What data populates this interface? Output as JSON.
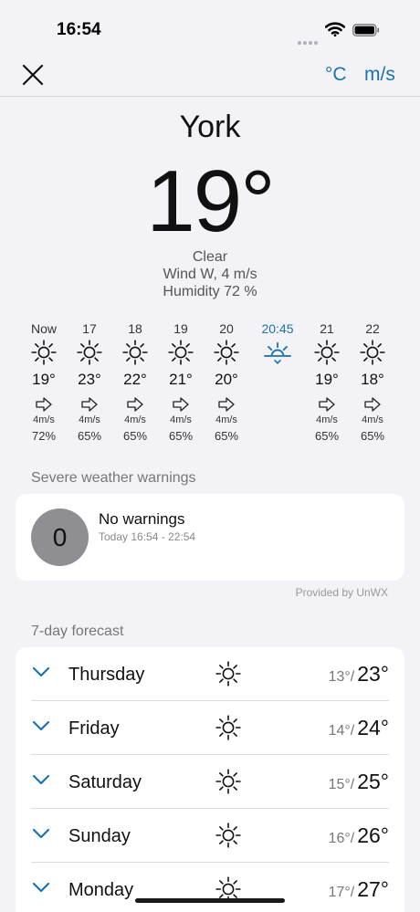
{
  "status": {
    "time": "16:54"
  },
  "toolbar": {
    "temp_unit": "°C",
    "wind_unit": "m/s"
  },
  "current": {
    "city": "York",
    "temperature": "19°",
    "condition": "Clear",
    "wind": "Wind W, 4 m/s",
    "humidity": "Humidity 72 %"
  },
  "hourly": [
    {
      "label": "Now",
      "icon": "sun-icon",
      "temp": "19°",
      "wind_dir": "W",
      "speed": "4m/s",
      "humidity": "72%"
    },
    {
      "label": "17",
      "icon": "sun-icon",
      "temp": "23°",
      "wind_dir": "W",
      "speed": "4m/s",
      "humidity": "65%"
    },
    {
      "label": "18",
      "icon": "sun-icon",
      "temp": "22°",
      "wind_dir": "W",
      "speed": "4m/s",
      "humidity": "65%"
    },
    {
      "label": "19",
      "icon": "sun-icon",
      "temp": "21°",
      "wind_dir": "W",
      "speed": "4m/s",
      "humidity": "65%"
    },
    {
      "label": "20",
      "icon": "sun-icon",
      "temp": "20°",
      "wind_dir": "W",
      "speed": "4m/s",
      "humidity": "65%"
    },
    {
      "label": "20:45",
      "icon": "sunset-icon",
      "accent": true
    },
    {
      "label": "21",
      "icon": "sun-icon",
      "temp": "19°",
      "wind_dir": "W",
      "speed": "4m/s",
      "humidity": "65%"
    },
    {
      "label": "22",
      "icon": "sun-icon",
      "temp": "18°",
      "wind_dir": "W",
      "speed": "4m/s",
      "humidity": "65%"
    }
  ],
  "warnings": {
    "section_title": "Severe weather warnings",
    "count": "0",
    "title": "No warnings",
    "period": "Today 16:54 - 22:54",
    "provider": "Provided by UnWX"
  },
  "forecast": {
    "section_title": "7-day forecast",
    "days": [
      {
        "day": "Thursday",
        "icon": "sun-icon",
        "low": "13°/",
        "high": "23°"
      },
      {
        "day": "Friday",
        "icon": "sun-icon",
        "low": "14°/",
        "high": "24°"
      },
      {
        "day": "Saturday",
        "icon": "sun-icon",
        "low": "15°/",
        "high": "25°"
      },
      {
        "day": "Sunday",
        "icon": "sun-icon",
        "low": "16°/",
        "high": "26°"
      },
      {
        "day": "Monday",
        "icon": "sun-icon",
        "low": "17°/",
        "high": "27°"
      }
    ]
  },
  "colors": {
    "accent": "#1a73b0",
    "background": "#f2f2f7",
    "warning_circle": "#8e8e93"
  }
}
